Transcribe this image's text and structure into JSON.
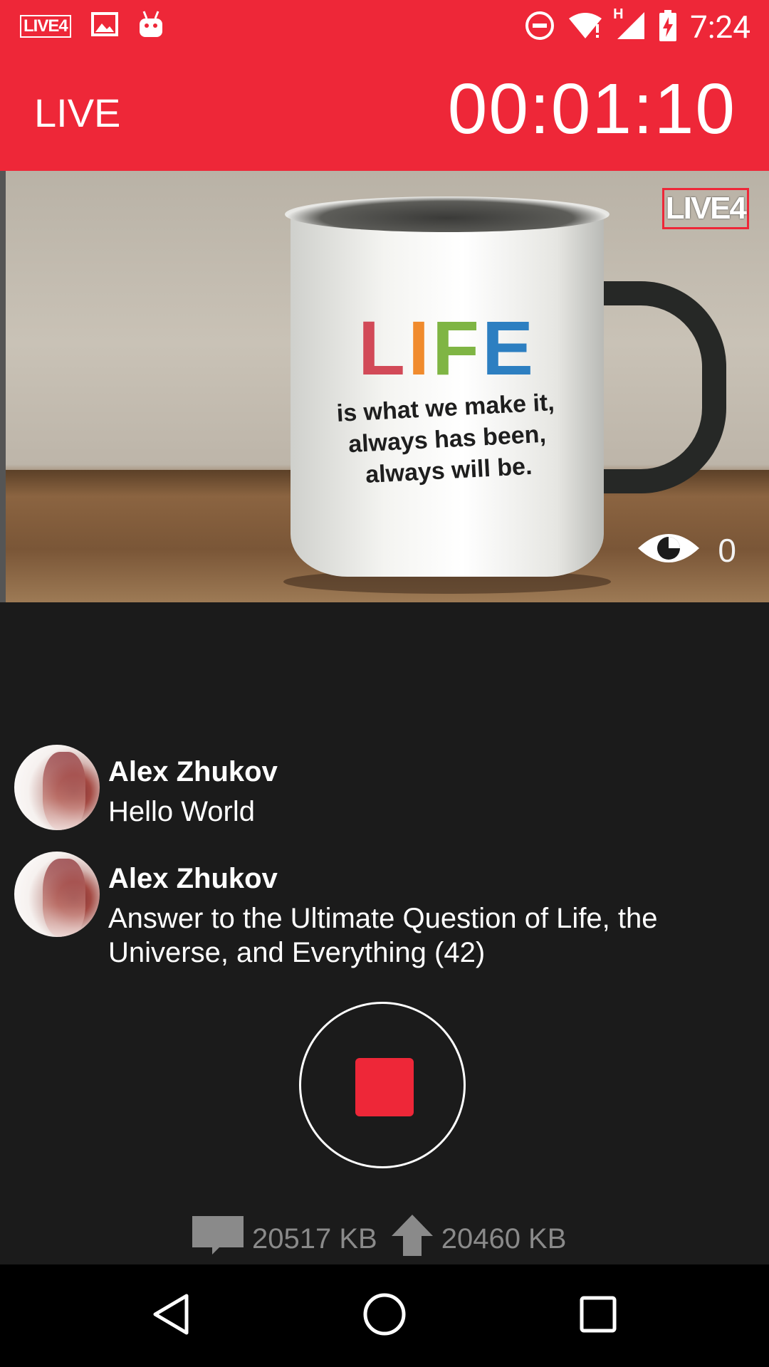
{
  "status_bar": {
    "app_badge": "LIVE4",
    "network_type": "H",
    "time": "7:24",
    "icons": [
      "live4-app-icon",
      "image-icon",
      "android-icon",
      "do-not-disturb-icon",
      "wifi-icon",
      "signal-icon",
      "battery-charging-icon"
    ]
  },
  "app_bar": {
    "title": "LIVE",
    "timer": "00:01:10"
  },
  "preview": {
    "watermark": "LIVE4",
    "mug_word": [
      "L",
      "I",
      "F",
      "E"
    ],
    "mug_tagline": [
      "is what we make it,",
      "always has been,",
      "always will be."
    ],
    "viewer_count": "0"
  },
  "comments": [
    {
      "author": "Alex Zhukov",
      "text": "Hello World"
    },
    {
      "author": "Alex Zhukov",
      "text": "Answer to the Ultimate Question of Life, the Universe, and Everything (42)"
    }
  ],
  "stats": {
    "received": "20517 KB",
    "sent": "20460 KB"
  },
  "colors": {
    "accent": "#ee2738",
    "background": "#1b1b1b",
    "muted_text": "#8a8a8a"
  }
}
